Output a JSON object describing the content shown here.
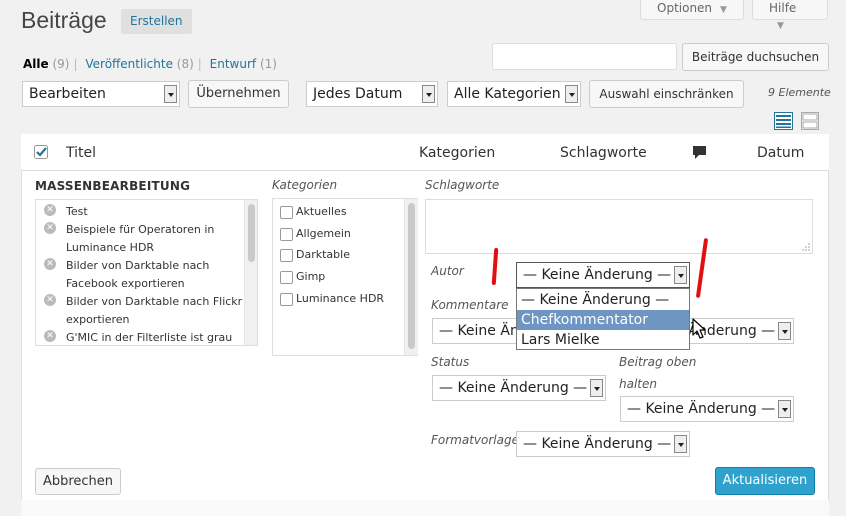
{
  "header": {
    "title": "Beiträge",
    "add_new": "Erstellen",
    "screen_options": "Optionen",
    "help": "Hilfe"
  },
  "filters": {
    "all_label": "Alle",
    "all_count": "(9)",
    "published_label": "Veröffentlichte",
    "published_count": "(8)",
    "draft_label": "Entwurf",
    "draft_count": "(1)"
  },
  "search": {
    "value": "",
    "button": "Beiträge duchsuchen"
  },
  "toolbar": {
    "bulk_action": "Bearbeiten",
    "apply": "Übernehmen",
    "date_filter": "Jedes Datum",
    "category_filter": "Alle Kategorien",
    "filter_button": "Auswahl einschränken",
    "item_count": "9 Elemente"
  },
  "table_header": {
    "title": "Titel",
    "categories": "Kategorien",
    "tags": "Schlagworte",
    "date": "Datum"
  },
  "bulk_edit": {
    "heading": "MASSENBEARBEITUNG",
    "posts": [
      "Test",
      "Beispiele für Operatoren in Luminance HDR",
      "Bilder von Darktable nach Facebook exportieren",
      "Bilder von Darktable nach Flickr exportieren",
      "G'MIC in der Filterliste ist grau"
    ],
    "categories_label": "Kategorien",
    "categories": [
      "Aktuelles",
      "Allgemein",
      "Darktable",
      "Gimp",
      "Luminance HDR"
    ],
    "tags_label": "Schlagworte",
    "author_label": "Autor",
    "author_value": "— Keine Änderung —",
    "author_options": [
      "— Keine Änderung —",
      "Chefkommentator",
      "Lars Mielke"
    ],
    "author_highlighted": 1,
    "comments_label": "Kommentare",
    "comments_value": "— Keine Änderung —",
    "pings_value": "— Keine Änderung —",
    "status_label": "Status",
    "status_value": "— Keine Änderung —",
    "sticky_label_1": "Beitrag oben",
    "sticky_label_2": "halten",
    "sticky_value": "— Keine Änderung —",
    "format_label": "Formatvorlage",
    "format_value": "— Keine Änderung —",
    "cancel": "Abbrechen",
    "update": "Aktualisieren"
  },
  "colors": {
    "accent": "#2ea2cc",
    "link": "#21759b",
    "highlight": "#6f96c3",
    "annotation": "#e01010"
  }
}
